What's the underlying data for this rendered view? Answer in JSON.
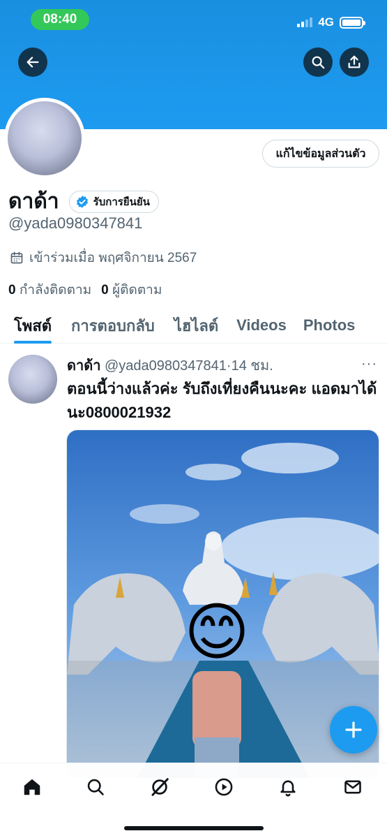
{
  "status_bar": {
    "time": "08:40",
    "network": "4G"
  },
  "header": {
    "back_icon": "arrow-left-icon",
    "search_icon": "search-icon",
    "share_icon": "share-icon"
  },
  "profile": {
    "edit_button_label": "แก้ไขข้อมูลส่วนตัว",
    "display_name": "ดาด้า",
    "verify_label": "รับการยืนยัน",
    "handle": "@yada0980347841",
    "joined": "เข้าร่วมเมื่อ พฤศจิกายน 2567",
    "following_count": "0",
    "following_label": "กำลังติดตาม",
    "followers_count": "0",
    "followers_label": "ผู้ติดตาม"
  },
  "tabs": [
    {
      "label": "โพสต์",
      "active": true
    },
    {
      "label": "การตอบกลับ",
      "active": false
    },
    {
      "label": "ไฮไลต์",
      "active": false
    },
    {
      "label": "Videos",
      "active": false
    },
    {
      "label": "Photos",
      "active": false
    }
  ],
  "post": {
    "name": "ดาด้า",
    "handle": "@yada0980347841",
    "separator": "·",
    "time": "14 ชม.",
    "more": "···",
    "text": "ตอนนี้ว่างแล้วค่ะ รับถึงเที่ยงคืนนะคะ แอดมาได้นะ0800021932",
    "media_emoji": "😊"
  },
  "bottom_nav": [
    "home-icon",
    "search-icon",
    "grok-icon",
    "play-icon",
    "bell-icon",
    "mail-icon"
  ],
  "colors": {
    "accent": "#1d9bf0",
    "status_green": "#34c759",
    "text_primary": "#0f1419",
    "text_secondary": "#536471"
  }
}
